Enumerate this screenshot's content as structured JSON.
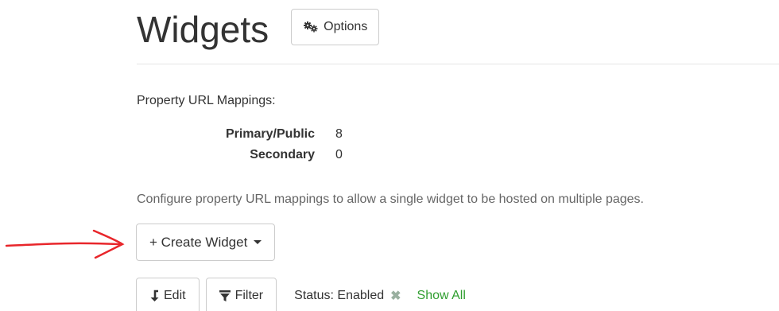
{
  "header": {
    "title": "Widgets",
    "options_label": "Options"
  },
  "mappings": {
    "heading": "Property URL Mappings:",
    "rows": [
      {
        "label": "Primary/Public",
        "value": "8"
      },
      {
        "label": "Secondary",
        "value": "0"
      }
    ]
  },
  "help_text": "Configure property URL mappings to allow a single widget to be hosted on multiple pages.",
  "create": {
    "label": "+ Create Widget"
  },
  "toolbar": {
    "edit_label": "Edit",
    "filter_label": "Filter",
    "status_text": "Status: Enabled",
    "show_all_label": "Show All"
  },
  "colors": {
    "annotation": "#e8262b",
    "show_all": "#2f9e2f",
    "clear_icon": "#9ab0a0"
  },
  "icons": {
    "options": "gears-icon",
    "create_caret": "caret-down-icon",
    "edit": "level-down-icon",
    "filter": "filter-icon",
    "clear": "close-icon"
  }
}
